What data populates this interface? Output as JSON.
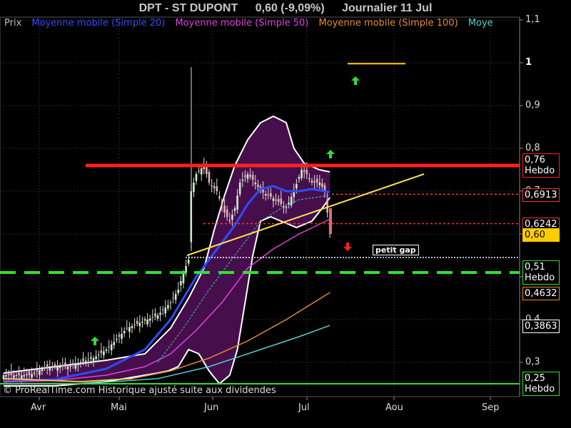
{
  "title": {
    "ticker": "DPT - ST DUPONT",
    "quote": "0,60 (-9,09%)",
    "period": "Journalier  11 Jul"
  },
  "legend": [
    {
      "label": "Prix",
      "color": "#bbbbbb"
    },
    {
      "label": "Moyenne mobile (Simple 20)",
      "color": "#2e4bff"
    },
    {
      "label": "Moyenne mobile (Simple 50)",
      "color": "#e040e0"
    },
    {
      "label": "Moyenne mobile (Simple 100)",
      "color": "#e88a30"
    },
    {
      "label": "Moye",
      "color": "#50d0d0"
    }
  ],
  "copyright": "© ProRealTime.com Historique ajusté suite aux dividendes",
  "annotation": "petit gap",
  "chart_data": {
    "type": "line",
    "x_ticks": [
      "Avr",
      "Mai",
      "Jun",
      "Jul",
      "Aou",
      "Sep"
    ],
    "y_ticks": [
      "1,1",
      "1",
      "0,9",
      "0,8",
      "0,7",
      "0,6",
      "0,5",
      "0,4",
      "0,3"
    ],
    "ylim": [
      0.24,
      1.12
    ],
    "levels": [
      {
        "label": "0,76",
        "sub": "Hebdo",
        "value": 0.76,
        "color": "#ff2020",
        "bg": "#000000",
        "fg": "#ffffff",
        "border": "#ff2020"
      },
      {
        "label": "0,6913",
        "sub": "",
        "value": 0.693,
        "color": "#ff3030",
        "bg": "#000000",
        "fg": "#ffffff",
        "border": "#ff3030"
      },
      {
        "label": "0,6242",
        "sub": "",
        "value": 0.6242,
        "color": "#ff3030",
        "bg": "#000000",
        "fg": "#ffffff",
        "border": "#ff3030"
      },
      {
        "label": "0,60",
        "sub": "",
        "value": 0.6,
        "color": "#ffcc00",
        "bg": "#ffcc00",
        "fg": "#000000",
        "border": "#ffcc00"
      },
      {
        "label": "0,51",
        "sub": "Hebdo",
        "value": 0.51,
        "color": "#30e030",
        "bg": "#000000",
        "fg": "#ffffff",
        "border": "#30e030"
      },
      {
        "label": "0,4632",
        "sub": "",
        "value": 0.4632,
        "color": "#e88a30",
        "bg": "#000000",
        "fg": "#ffffff",
        "border": "#e88a30"
      },
      {
        "label": "0,3863",
        "sub": "",
        "value": 0.3863,
        "color": "#50d0d0",
        "bg": "#000000",
        "fg": "#ffffff",
        "border": "#ffffff"
      },
      {
        "label": "0,25",
        "sub": "Hebdo",
        "value": 0.25,
        "color": "#30e030",
        "bg": "#000000",
        "fg": "#ffffff",
        "border": "#30e030"
      }
    ],
    "series": [
      {
        "name": "Moyenne mobile (Simple 20)",
        "color": "#2e4bff",
        "points": [
          [
            0,
            0.255
          ],
          [
            20,
            0.26
          ],
          [
            40,
            0.285
          ],
          [
            55,
            0.33
          ],
          [
            65,
            0.4
          ],
          [
            75,
            0.5
          ],
          [
            85,
            0.58
          ],
          [
            90,
            0.62
          ],
          [
            95,
            0.67
          ],
          [
            100,
            0.705
          ],
          [
            105,
            0.712
          ],
          [
            110,
            0.7
          ],
          [
            115,
            0.7
          ],
          [
            120,
            0.705
          ],
          [
            125,
            0.7
          ],
          [
            127,
            0.698
          ]
        ]
      },
      {
        "name": "Moyenne mobile (Simple 50)",
        "color": "#e040e0",
        "points": [
          [
            0,
            0.255
          ],
          [
            20,
            0.258
          ],
          [
            40,
            0.27
          ],
          [
            55,
            0.29
          ],
          [
            65,
            0.32
          ],
          [
            75,
            0.375
          ],
          [
            85,
            0.44
          ],
          [
            95,
            0.52
          ],
          [
            105,
            0.565
          ],
          [
            115,
            0.6
          ],
          [
            122,
            0.62
          ],
          [
            127,
            0.635
          ]
        ]
      },
      {
        "name": "Moyenne mobile (Simple 100)",
        "color": "#e88a30",
        "points": [
          [
            0,
            0.262
          ],
          [
            30,
            0.255
          ],
          [
            50,
            0.262
          ],
          [
            65,
            0.28
          ],
          [
            80,
            0.31
          ],
          [
            95,
            0.35
          ],
          [
            110,
            0.4
          ],
          [
            127,
            0.4632
          ]
        ]
      },
      {
        "name": "Moye",
        "color": "#50d0d0",
        "points": [
          [
            0,
            0.25
          ],
          [
            30,
            0.25
          ],
          [
            60,
            0.262
          ],
          [
            80,
            0.29
          ],
          [
            100,
            0.33
          ],
          [
            115,
            0.36
          ],
          [
            127,
            0.3863
          ]
        ]
      }
    ]
  }
}
